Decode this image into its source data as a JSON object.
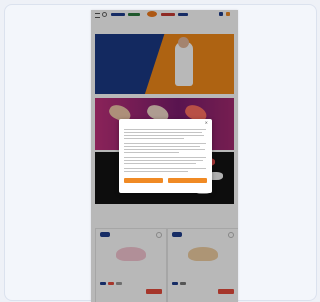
{
  "banners": [
    {
      "title_top": "",
      "title_bottom": ""
    },
    {
      "left_text": "",
      "right_text": ""
    },
    {}
  ],
  "section": {
    "title": "",
    "subtitle": ""
  },
  "products": [
    {
      "name": "",
      "price": "",
      "cart": ""
    },
    {
      "name": "",
      "price": "",
      "cart": ""
    }
  ],
  "modal": {
    "title": "",
    "accept": "",
    "settings": "",
    "footer": ""
  },
  "colors": {
    "primary_blue": "#1f3d8c",
    "accent_orange": "#f08a24",
    "pink": "#c0317b"
  }
}
